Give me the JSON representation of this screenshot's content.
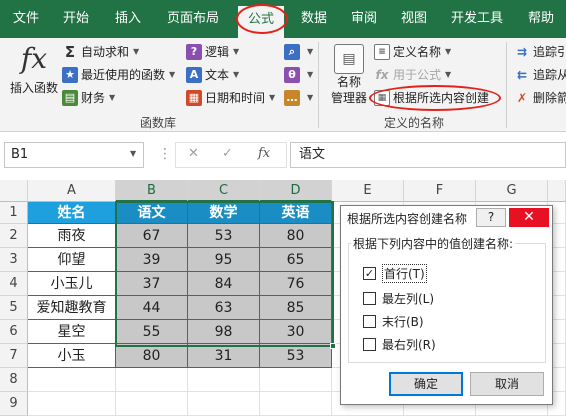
{
  "tabs": [
    {
      "label": "文件"
    },
    {
      "label": "开始"
    },
    {
      "label": "插入"
    },
    {
      "label": "页面布局"
    },
    {
      "label": "公式"
    },
    {
      "label": "数据"
    },
    {
      "label": "审阅"
    },
    {
      "label": "视图"
    },
    {
      "label": "开发工具"
    },
    {
      "label": "帮助"
    }
  ],
  "ribbon": {
    "function_library": {
      "insert_function": "插入函数",
      "autosum": "自动求和",
      "recently_used": "最近使用的函数",
      "financial": "财务",
      "logical": "逻辑",
      "text": "文本",
      "date_time": "日期和时间",
      "group_label": "函数库"
    },
    "defined_names": {
      "name_manager_line1": "名称",
      "name_manager_line2": "管理器",
      "define_name": "定义名称",
      "use_in_formula": "用于公式",
      "create_from_selection": "根据所选内容创建",
      "group_label": "定义的名称"
    },
    "auditing": {
      "trace_precedents": "追踪引",
      "trace_dependents": "追踪从",
      "remove_arrows": "删除箭"
    },
    "accent_color": "#217346",
    "highlight_color": "#e2231a"
  },
  "formula_bar": {
    "name_box": "B1",
    "fx_label": "fx",
    "cancel_symbol": "✕",
    "enter_symbol": "✓",
    "value": "语文"
  },
  "sheet": {
    "columns": [
      "A",
      "B",
      "C",
      "D",
      "E",
      "F",
      "G"
    ],
    "rows": [
      "1",
      "2",
      "3",
      "4",
      "5",
      "6",
      "7",
      "8",
      "9"
    ],
    "header_row": [
      "姓名",
      "语文",
      "数学",
      "英语"
    ],
    "data_rows": [
      [
        "雨夜",
        "67",
        "53",
        "80"
      ],
      [
        "仰望",
        "39",
        "95",
        "65"
      ],
      [
        "小玉儿",
        "37",
        "84",
        "76"
      ],
      [
        "爱知趣教育",
        "44",
        "63",
        "85"
      ],
      [
        "星空",
        "55",
        "98",
        "30"
      ],
      [
        "小玉",
        "80",
        "31",
        "53"
      ]
    ],
    "header_color": "#1ea0de",
    "selection_fill": "#c8c8c8"
  },
  "dialog": {
    "title": "根据所选内容创建名称",
    "help": "?",
    "close": "✕",
    "legend": "根据下列内容中的值创建名称:",
    "options": [
      {
        "label": "首行(T)",
        "checked": true
      },
      {
        "label": "最左列(L)",
        "checked": false
      },
      {
        "label": "末行(B)",
        "checked": false
      },
      {
        "label": "最右列(R)",
        "checked": false
      }
    ],
    "ok": "确定",
    "cancel": "取消"
  }
}
